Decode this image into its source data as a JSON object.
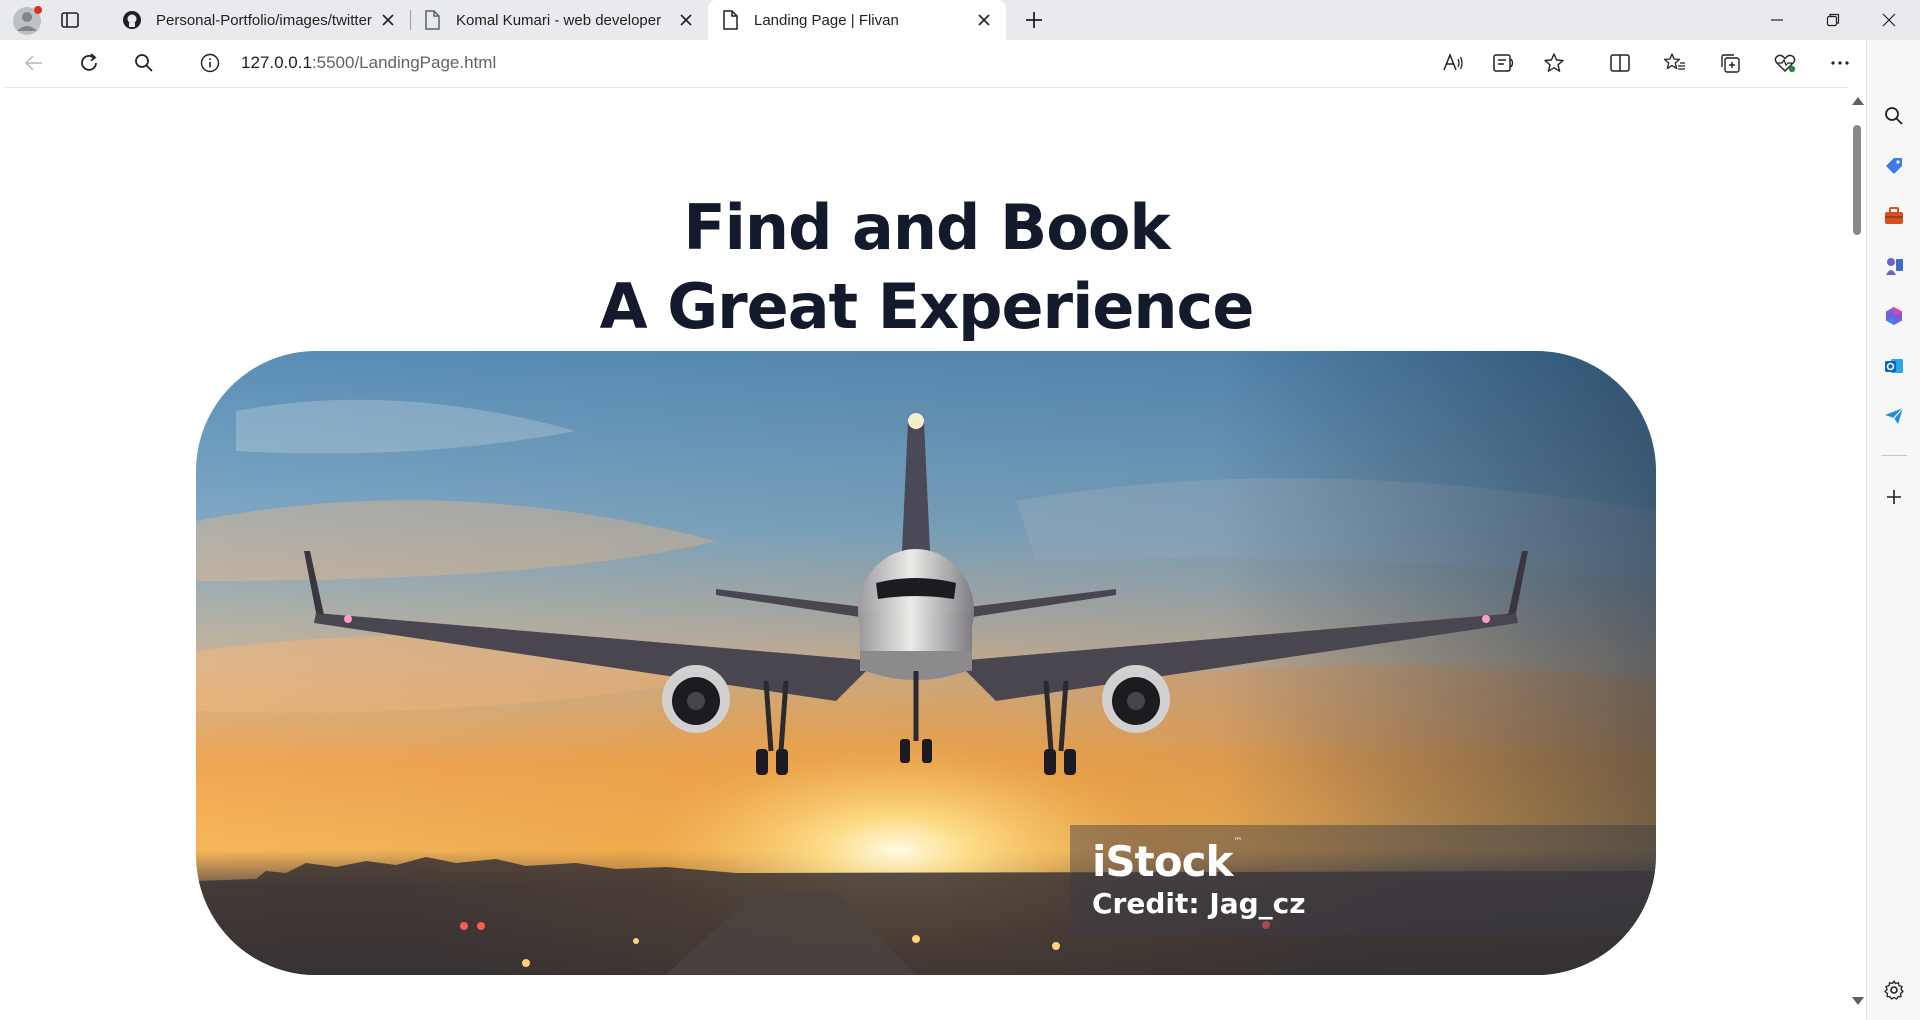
{
  "browser": {
    "tabs": [
      {
        "title": "Personal-Portfolio/images/twitter",
        "favicon": "github-icon",
        "active": false
      },
      {
        "title": "Komal Kumari - web developer",
        "favicon": "page-icon",
        "active": false
      },
      {
        "title": "Landing Page | Flivan",
        "favicon": "page-icon",
        "active": true
      }
    ],
    "address_bar": {
      "url_host": "127.0.0.1",
      "url_rest": ":5500/LandingPage.html"
    },
    "toolbar_icons": [
      "back-icon",
      "refresh-icon",
      "search-icon",
      "info-icon",
      "read-aloud-icon",
      "immersive-reader-icon",
      "favorite-star-icon",
      "split-screen-icon",
      "favorites-icon",
      "collections-icon",
      "browser-essentials-icon",
      "more-icon",
      "copilot-icon"
    ],
    "sidebar_icons": [
      "search-icon",
      "shopping-tag-icon",
      "tools-icon",
      "games-icon",
      "microsoft-365-icon",
      "outlook-icon",
      "send-icon",
      "add-icon",
      "settings-icon"
    ]
  },
  "page": {
    "headline_line1": "Find and Book",
    "headline_line2": "A Great Experience",
    "hero_image": {
      "subject": "airplane landing at sunset",
      "watermark_brand": "iStock",
      "watermark_tm": "™",
      "watermark_credit": "Credit: Jag_cz"
    }
  },
  "colors": {
    "headline": "#121a2c",
    "tabstrip_bg": "#e8eaed",
    "active_tab_bg": "#ffffff"
  }
}
